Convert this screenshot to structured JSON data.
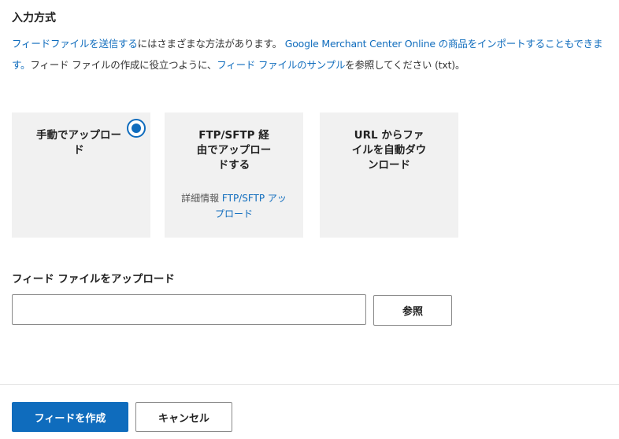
{
  "section": {
    "title": "入力方式"
  },
  "description": {
    "link1": "フィードファイルを送信する",
    "text1": "にはさまざまな方法があります。",
    "link2": "Google Merchant Center Online の商品をインポートすることもできます。",
    "text2": "フィード ファイルの作成に役立つように、",
    "link3": "フィード ファイルのサンプル",
    "text3": "を参照してください (txt)。"
  },
  "methods": [
    {
      "label": "手動でアップロード",
      "selected": true
    },
    {
      "label": "FTP/SFTP 経由でアップロードする",
      "detail_prefix": "詳細情報",
      "detail_link": "FTP/SFTP アップロード"
    },
    {
      "label": "URL からファイルを自動ダウンロード"
    }
  ],
  "upload": {
    "label": "フィード ファイルをアップロード",
    "value": "",
    "browse_label": "参照"
  },
  "footer": {
    "create_label": "フィードを作成",
    "cancel_label": "キャンセル"
  },
  "colors": {
    "accent": "#0f6cbd",
    "card_bg": "#f1f1f1"
  }
}
